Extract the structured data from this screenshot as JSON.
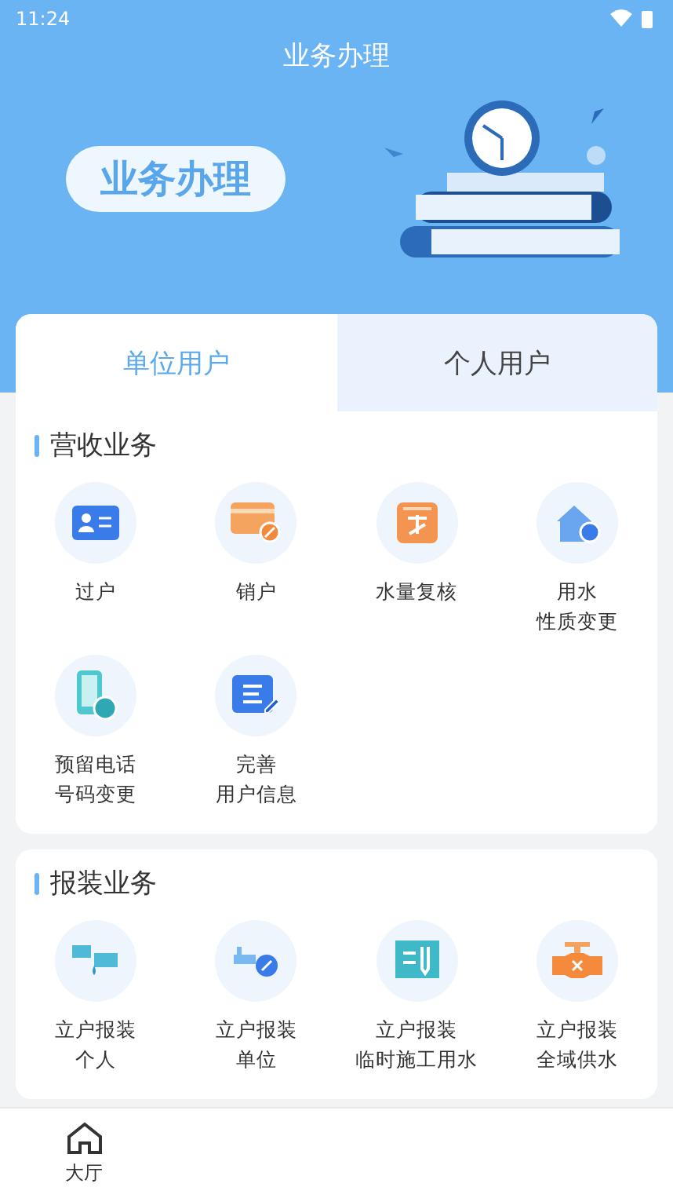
{
  "status_bar": {
    "time": "11:24"
  },
  "title": "业务办理",
  "banner": {
    "label": "业务办理"
  },
  "user_tabs": [
    {
      "label": "单位用户",
      "selected": true
    },
    {
      "label": "个人用户",
      "selected": false
    }
  ],
  "sections": [
    {
      "title": "营收业务",
      "items": [
        {
          "lines": [
            "过户"
          ]
        },
        {
          "lines": [
            "销户"
          ]
        },
        {
          "lines": [
            "水量复核"
          ]
        },
        {
          "lines": [
            "用水",
            "性质变更"
          ]
        },
        {
          "lines": [
            "预留电话",
            "号码变更"
          ]
        },
        {
          "lines": [
            "完善",
            "用户信息"
          ]
        }
      ]
    },
    {
      "title": "报装业务",
      "items": [
        {
          "lines": [
            "立户报装",
            "个人"
          ]
        },
        {
          "lines": [
            "立户报装",
            "单位"
          ]
        },
        {
          "lines": [
            "立户报装",
            "临时施工用水"
          ]
        },
        {
          "lines": [
            "立户报装",
            "全域供水"
          ]
        }
      ]
    }
  ],
  "nav": [
    {
      "label": "大厅",
      "selected": false
    }
  ]
}
